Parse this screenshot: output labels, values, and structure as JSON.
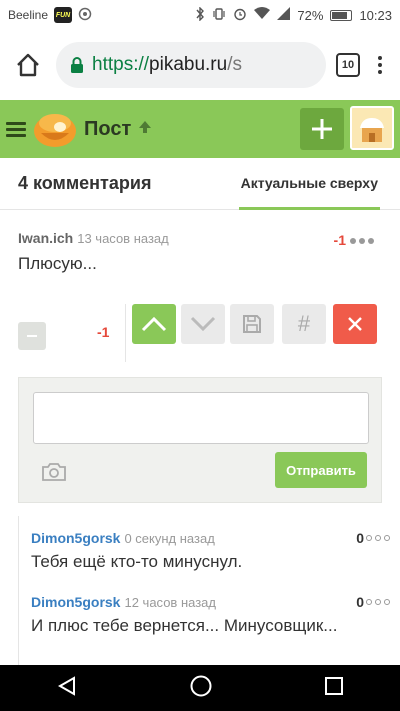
{
  "statusbar": {
    "carrier": "Beeline",
    "app_icon_text": "FUN",
    "battery": "72%",
    "time": "10:23"
  },
  "browser": {
    "url_scheme": "https://",
    "url_host": "pikabu.ru",
    "url_rest": "/s",
    "tab_count": "10"
  },
  "pikabu_header": {
    "title": "Пост"
  },
  "comments_header": {
    "count_label": "4 комментария",
    "sort_label": "Актуальные сверху"
  },
  "main_comment": {
    "author": "Iwan.ich",
    "time": "13 часов назад",
    "rating": "-1",
    "text": "Плюсую..."
  },
  "actions": {
    "rating": "-1",
    "hash": "#"
  },
  "reply_form": {
    "input_value": "",
    "send_label": "Отправить"
  },
  "replies": [
    {
      "author": "Dimon5gorsk",
      "time": "0 секунд назад",
      "rating": "0",
      "text": "Тебя ещё кто-то минуснул."
    },
    {
      "author": "Dimon5gorsk",
      "time": "12 часов назад",
      "rating": "0",
      "text": "И плюс тебе вернется... Минусовщик..."
    }
  ],
  "colors": {
    "pikabu_green": "#8ac858",
    "negative_red": "#e5483a",
    "author_blue": "#3a7fc1",
    "close_red": "#f05b4a"
  }
}
